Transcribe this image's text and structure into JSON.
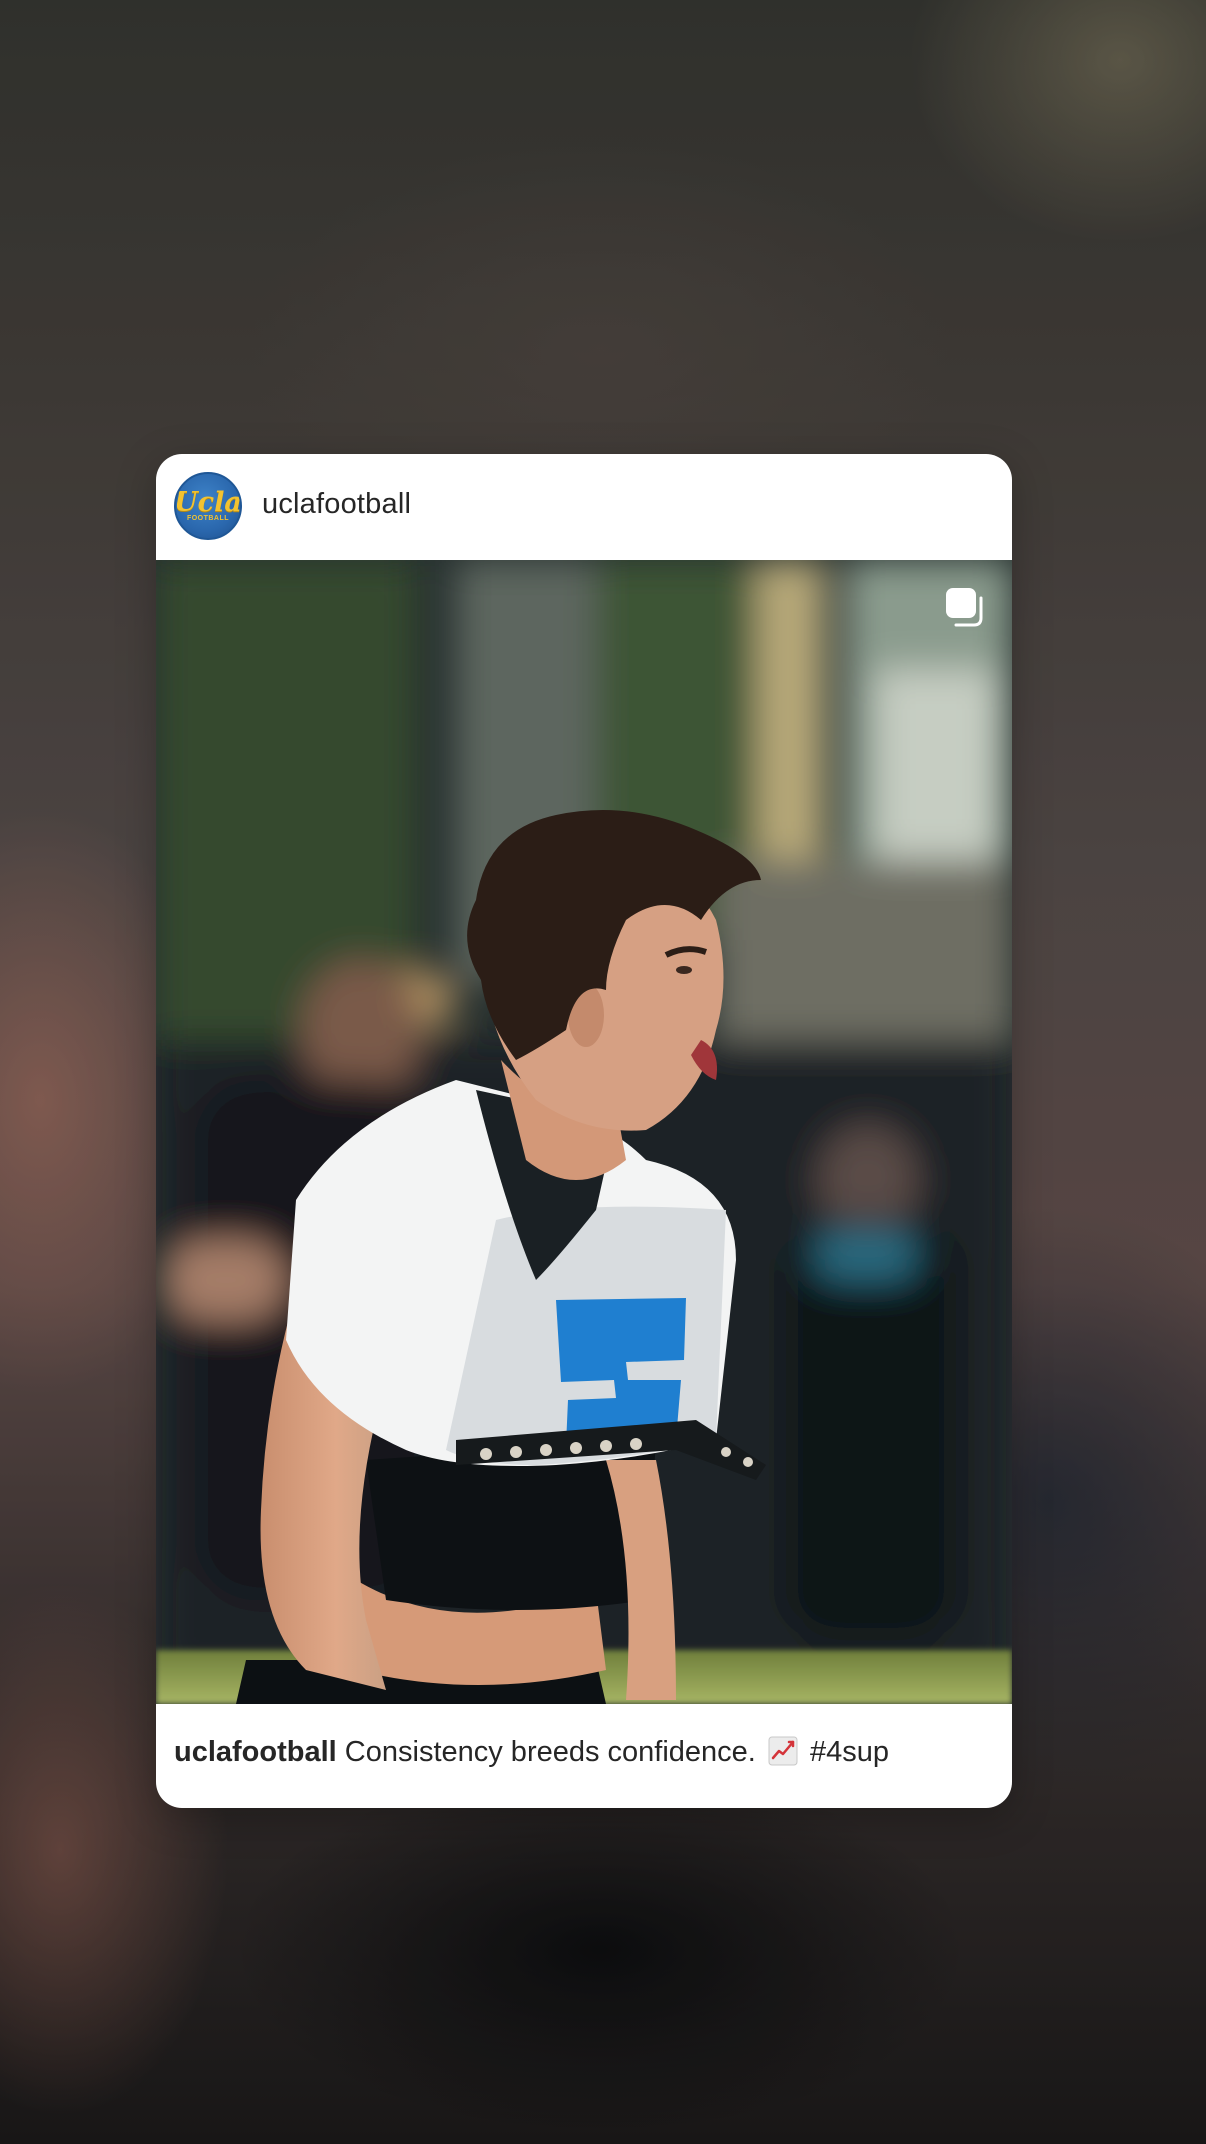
{
  "post": {
    "username": "uclafootball",
    "avatar": {
      "logo_text": "Ucla",
      "logo_subtext": "FOOTBALL",
      "colors": {
        "circle": "#2a67ad",
        "lettering": "#f2c230"
      }
    },
    "media_type_icon": "multiple-photos-icon",
    "photo": {
      "jersey_color": "#ffffff",
      "jersey_number_color": "#1f7fd0"
    },
    "caption": {
      "username": "uclafootball",
      "text": "Consistency breeds confidence.",
      "emoji_icon": "chart-increasing-icon",
      "hashtag": "#4sup"
    }
  }
}
